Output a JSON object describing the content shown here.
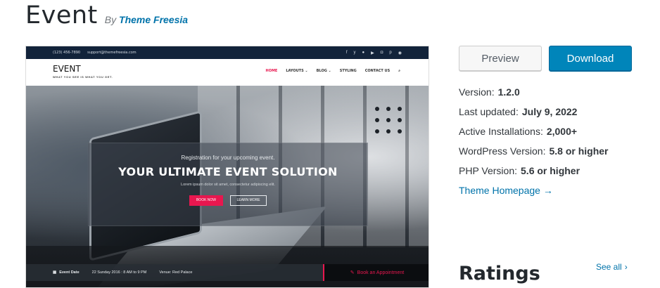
{
  "header": {
    "theme_name": "Event",
    "by_prefix": "By",
    "author": "Theme Freesia"
  },
  "screenshot": {
    "topbar": {
      "phone": "(123) 456-7890",
      "email": "support@themefreesia.com",
      "social_icons": [
        "f",
        "y",
        "●",
        "▶",
        "◘",
        "p",
        "◉"
      ]
    },
    "logo": {
      "name": "EVENT",
      "tagline": "WHAT YOU SEE IS WHAT YOU GET."
    },
    "menu": [
      "HOME",
      "LAYOUTS ⌄",
      "BLOG ⌄",
      "STYLING",
      "CONTACT US",
      "⌕"
    ],
    "hero": {
      "sub": "Registration for your upcoming event.",
      "headline": "YOUR ULTIMATE EVENT SOLUTION",
      "lorem": "Lorem ipsum dolor sit amet, consectetur adipiscing elit.",
      "book_now": "BOOK NOW",
      "learn_more": "LEARN MORE"
    },
    "eventbar": {
      "label": "Event Date",
      "date": "22 Sunday 2016 : 8 AM to 9 PM",
      "venue": "Venue: Red Palace",
      "appointment": "Book an Appointment"
    }
  },
  "actions": {
    "preview": "Preview",
    "download": "Download"
  },
  "meta": [
    {
      "label": "Version:",
      "value": "1.2.0"
    },
    {
      "label": "Last updated:",
      "value": "July 9, 2022"
    },
    {
      "label": "Active Installations:",
      "value": "2,000+"
    },
    {
      "label": "WordPress Version:",
      "value": "5.8 or higher"
    },
    {
      "label": "PHP Version:",
      "value": "5.6 or higher"
    }
  ],
  "homepage_link": "Theme Homepage →",
  "ratings": {
    "heading": "Ratings",
    "see_all": "See all"
  },
  "colors": {
    "accent": "#0085ba",
    "link": "#0073aa",
    "theme_pink": "#e8174f"
  }
}
